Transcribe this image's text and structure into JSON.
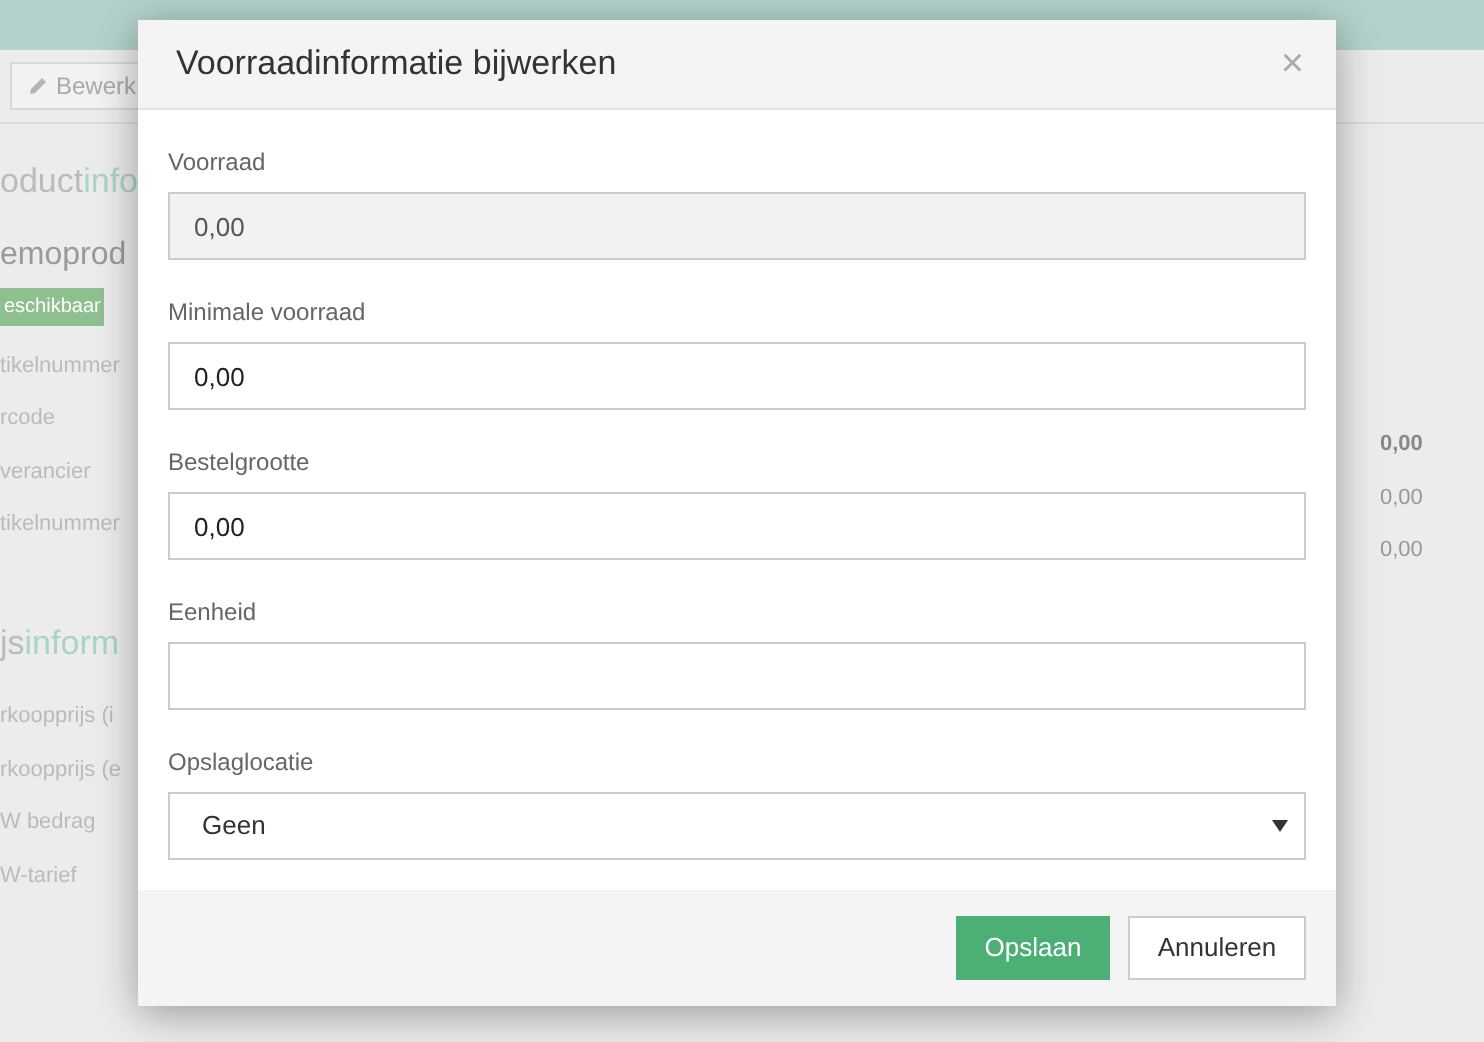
{
  "background": {
    "edit_button": "Bewerk",
    "section_title": {
      "plain": "oduct",
      "accent": "info"
    },
    "product_name": "emoprod",
    "status_badge": "eschikbaar",
    "labels": [
      "tikelnummer",
      "rcode",
      "verancier",
      "tikelnummer"
    ],
    "values": [
      {
        "text": "0,00",
        "bold": true
      },
      {
        "text": "0,00",
        "bold": false
      },
      {
        "text": "0,00",
        "bold": false
      }
    ],
    "price_title": {
      "plain": "js",
      "accent": "inform"
    },
    "price_labels": [
      "rkoopprijs (i",
      "rkoopprijs (e",
      "W bedrag",
      "W-tarief"
    ]
  },
  "dialog": {
    "title": "Voorraadinformatie bijwerken",
    "close": "×",
    "fields": [
      {
        "kind": "text",
        "label": "Voorraad",
        "value": "0,00",
        "disabled": true
      },
      {
        "kind": "text",
        "label": "Minimale voorraad",
        "value": "0,00",
        "disabled": false
      },
      {
        "kind": "text",
        "label": "Bestelgrootte",
        "value": "0,00",
        "disabled": false
      },
      {
        "kind": "text",
        "label": "Eenheid",
        "disabled": false
      },
      {
        "kind": "select",
        "label": "Opslaglocatie",
        "value": "Geen",
        "disabled": false
      }
    ],
    "buttons": [
      {
        "label": "Opslaan",
        "kind": "primary"
      },
      {
        "label": "Annuleren",
        "kind": "default"
      }
    ]
  }
}
